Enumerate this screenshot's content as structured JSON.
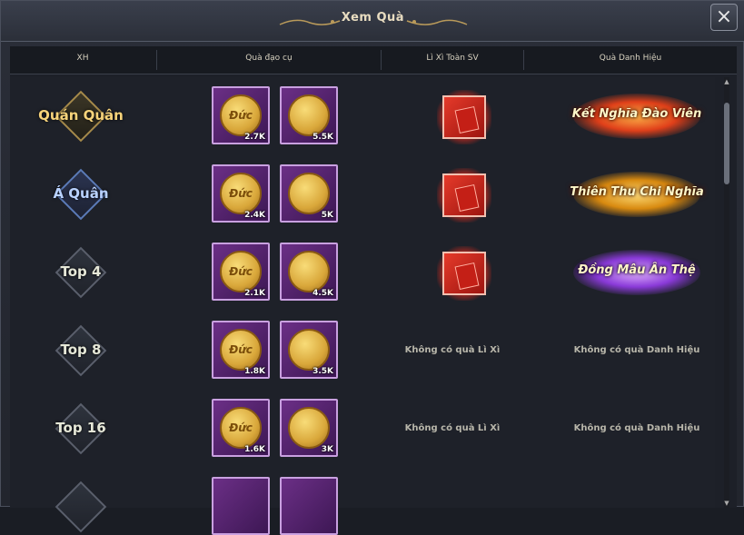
{
  "window": {
    "title": "Xem Quà",
    "close_label": "×"
  },
  "columns": [
    "XH",
    "Quà đạo cụ",
    "Lì Xì Toàn SV",
    "Quà Danh Hiệu"
  ],
  "rows": [
    {
      "rank": "Quán Quân",
      "coin1_label": "Đức",
      "coin1_qty": "2.7K",
      "coin2_qty": "5.5K",
      "lixi": true,
      "title_text": "Kết Nghĩa Đào Viên",
      "title_color": "#ff7a1a"
    },
    {
      "rank": "Á Quân",
      "coin1_label": "Đức",
      "coin1_qty": "2.4K",
      "coin2_qty": "5K",
      "lixi": true,
      "title_text": "Thiên Thu Chi Nghĩa",
      "title_color": "#ffb020"
    },
    {
      "rank": "Top 4",
      "coin1_label": "Đức",
      "coin1_qty": "2.1K",
      "coin2_qty": "4.5K",
      "lixi": true,
      "title_text": "Đồng Mâu Ân Thệ",
      "title_color": "#b46cff"
    },
    {
      "rank": "Top 8",
      "coin1_label": "Đức",
      "coin1_qty": "1.8K",
      "coin2_qty": "3.5K",
      "lixi": false,
      "no_lixi": "Không có quà Lì Xì",
      "no_title": "Không có quà Danh Hiệu"
    },
    {
      "rank": "Top 16",
      "coin1_label": "Đức",
      "coin1_qty": "1.6K",
      "coin2_qty": "3K",
      "lixi": false,
      "no_lixi": "Không có quà Lì Xì",
      "no_title": "Không có quà Danh Hiệu"
    }
  ],
  "colors": {
    "rank1": "#f6d37a",
    "rank2": "#a9c6ff",
    "rank_other": "#e6edd0"
  }
}
